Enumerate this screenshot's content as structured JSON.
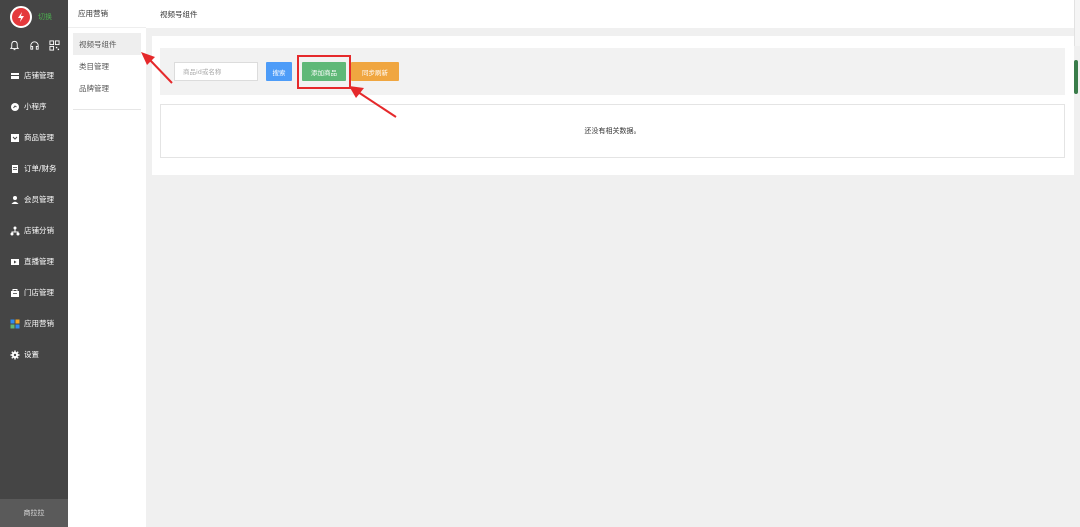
{
  "sidebar": {
    "logo_text": "切换",
    "menu": [
      {
        "label": "店铺管理",
        "icon": "store-icon"
      },
      {
        "label": "小程序",
        "icon": "miniprogram-icon"
      },
      {
        "label": "商品管理",
        "icon": "goods-icon"
      },
      {
        "label": "订单/财务",
        "icon": "order-icon"
      },
      {
        "label": "会员管理",
        "icon": "member-icon"
      },
      {
        "label": "店铺分销",
        "icon": "distribution-icon"
      },
      {
        "label": "直播管理",
        "icon": "live-icon"
      },
      {
        "label": "门店管理",
        "icon": "shop-icon"
      },
      {
        "label": "应用营销",
        "icon": "apps-icon"
      },
      {
        "label": "设置",
        "icon": "gear-icon"
      }
    ],
    "footer": "商拉拉"
  },
  "subnav": {
    "title": "应用营销",
    "items": [
      {
        "label": "视频号组件"
      },
      {
        "label": "类目管理"
      },
      {
        "label": "品牌管理"
      }
    ]
  },
  "header": {
    "title": "视频号组件"
  },
  "filter": {
    "search_placeholder": "商品id或名称",
    "search_label": "搜索",
    "add_label": "添加商品",
    "sync_label": "同步刷新"
  },
  "table": {
    "empty_text": "还没有相关数据。"
  },
  "colors": {
    "sidebar_bg": "#454545",
    "search_button": "#4d9cf8",
    "add_button": "#5fb878",
    "sync_button": "#f0a640",
    "annotation": "#e5292b"
  }
}
